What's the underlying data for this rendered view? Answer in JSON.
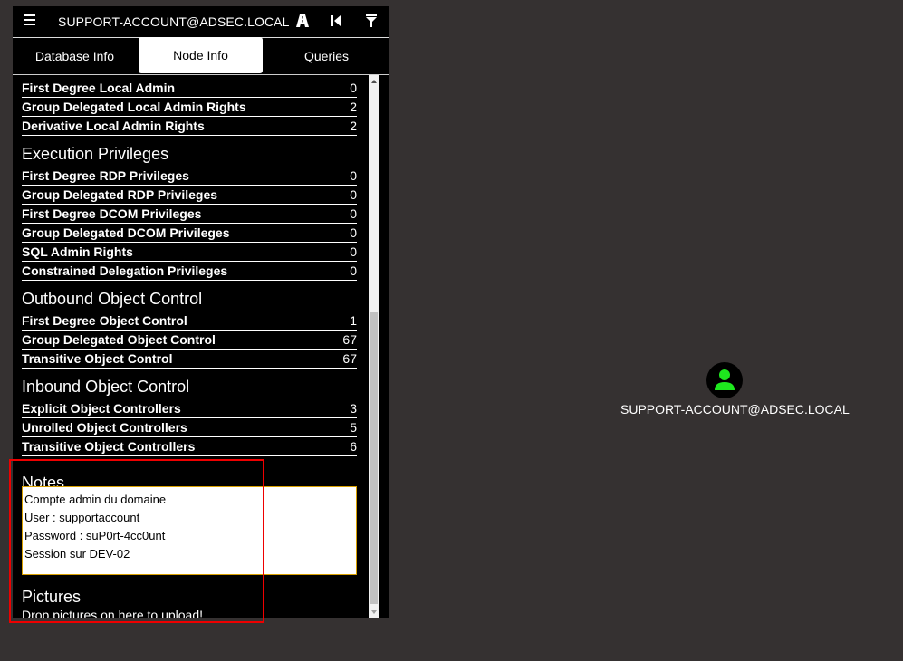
{
  "header": {
    "search_value": "SUPPORT-ACCOUNT@ADSEC.LOCAL",
    "icons": [
      "menu-icon",
      "pathfinding-icon",
      "back-icon",
      "filter-icon"
    ]
  },
  "tabs": [
    {
      "label": "Database Info",
      "active": false
    },
    {
      "label": "Node Info",
      "active": true
    },
    {
      "label": "Queries",
      "active": false
    }
  ],
  "local_admin_rows": [
    {
      "label": "First Degree Local Admin",
      "value": "0"
    },
    {
      "label": "Group Delegated Local Admin Rights",
      "value": "2"
    },
    {
      "label": "Derivative Local Admin Rights",
      "value": "2"
    }
  ],
  "execution": {
    "title": "Execution Privileges",
    "rows": [
      {
        "label": "First Degree RDP Privileges",
        "value": "0"
      },
      {
        "label": "Group Delegated RDP Privileges",
        "value": "0"
      },
      {
        "label": "First Degree DCOM Privileges",
        "value": "0"
      },
      {
        "label": "Group Delegated DCOM Privileges",
        "value": "0"
      },
      {
        "label": "SQL Admin Rights",
        "value": "0"
      },
      {
        "label": "Constrained Delegation Privileges",
        "value": "0"
      }
    ]
  },
  "outbound": {
    "title": "Outbound Object Control",
    "rows": [
      {
        "label": "First Degree Object Control",
        "value": "1"
      },
      {
        "label": "Group Delegated Object Control",
        "value": "67"
      },
      {
        "label": "Transitive Object Control",
        "value": "67"
      }
    ]
  },
  "inbound": {
    "title": "Inbound Object Control",
    "rows": [
      {
        "label": "Explicit Object Controllers",
        "value": "3"
      },
      {
        "label": "Unrolled Object Controllers",
        "value": "5"
      },
      {
        "label": "Transitive Object Controllers",
        "value": "6"
      }
    ]
  },
  "notes": {
    "title": "Notes",
    "lines": [
      "Compte admin du domaine",
      "User : supportaccount",
      "Password : suP0rt-4cc0unt",
      "Session sur DEV-02"
    ]
  },
  "pictures": {
    "title": "Pictures",
    "drop_text": "Drop pictures on here to upload!"
  },
  "graph": {
    "node_label": "SUPPORT-ACCOUNT@ADSEC.LOCAL",
    "node_icon": "user-icon",
    "node_icon_color": "#1ee81e"
  },
  "colors": {
    "background": "#353131",
    "panel": "#000000",
    "highlight": "#e00000",
    "notes_border": "#d9a000"
  }
}
